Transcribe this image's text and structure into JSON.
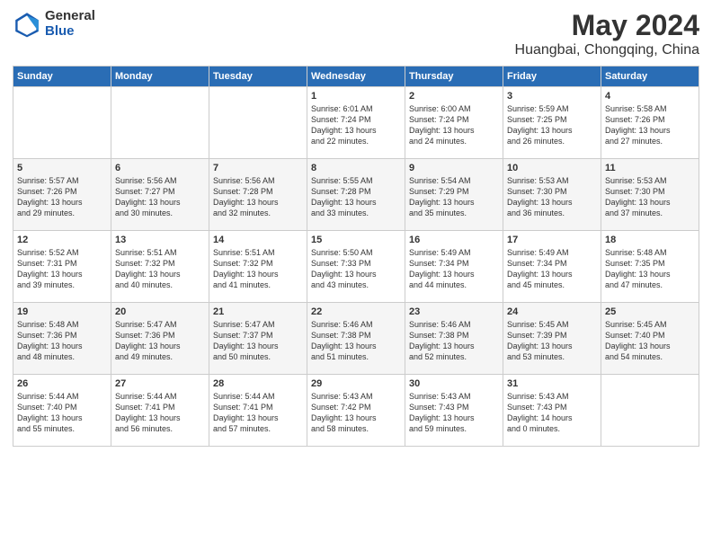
{
  "header": {
    "logo_general": "General",
    "logo_blue": "Blue",
    "title": "May 2024",
    "subtitle": "Huangbai, Chongqing, China"
  },
  "days_of_week": [
    "Sunday",
    "Monday",
    "Tuesday",
    "Wednesday",
    "Thursday",
    "Friday",
    "Saturday"
  ],
  "weeks": [
    [
      {
        "day": "",
        "content": ""
      },
      {
        "day": "",
        "content": ""
      },
      {
        "day": "",
        "content": ""
      },
      {
        "day": "1",
        "content": "Sunrise: 6:01 AM\nSunset: 7:24 PM\nDaylight: 13 hours\nand 22 minutes."
      },
      {
        "day": "2",
        "content": "Sunrise: 6:00 AM\nSunset: 7:24 PM\nDaylight: 13 hours\nand 24 minutes."
      },
      {
        "day": "3",
        "content": "Sunrise: 5:59 AM\nSunset: 7:25 PM\nDaylight: 13 hours\nand 26 minutes."
      },
      {
        "day": "4",
        "content": "Sunrise: 5:58 AM\nSunset: 7:26 PM\nDaylight: 13 hours\nand 27 minutes."
      }
    ],
    [
      {
        "day": "5",
        "content": "Sunrise: 5:57 AM\nSunset: 7:26 PM\nDaylight: 13 hours\nand 29 minutes."
      },
      {
        "day": "6",
        "content": "Sunrise: 5:56 AM\nSunset: 7:27 PM\nDaylight: 13 hours\nand 30 minutes."
      },
      {
        "day": "7",
        "content": "Sunrise: 5:56 AM\nSunset: 7:28 PM\nDaylight: 13 hours\nand 32 minutes."
      },
      {
        "day": "8",
        "content": "Sunrise: 5:55 AM\nSunset: 7:28 PM\nDaylight: 13 hours\nand 33 minutes."
      },
      {
        "day": "9",
        "content": "Sunrise: 5:54 AM\nSunset: 7:29 PM\nDaylight: 13 hours\nand 35 minutes."
      },
      {
        "day": "10",
        "content": "Sunrise: 5:53 AM\nSunset: 7:30 PM\nDaylight: 13 hours\nand 36 minutes."
      },
      {
        "day": "11",
        "content": "Sunrise: 5:53 AM\nSunset: 7:30 PM\nDaylight: 13 hours\nand 37 minutes."
      }
    ],
    [
      {
        "day": "12",
        "content": "Sunrise: 5:52 AM\nSunset: 7:31 PM\nDaylight: 13 hours\nand 39 minutes."
      },
      {
        "day": "13",
        "content": "Sunrise: 5:51 AM\nSunset: 7:32 PM\nDaylight: 13 hours\nand 40 minutes."
      },
      {
        "day": "14",
        "content": "Sunrise: 5:51 AM\nSunset: 7:32 PM\nDaylight: 13 hours\nand 41 minutes."
      },
      {
        "day": "15",
        "content": "Sunrise: 5:50 AM\nSunset: 7:33 PM\nDaylight: 13 hours\nand 43 minutes."
      },
      {
        "day": "16",
        "content": "Sunrise: 5:49 AM\nSunset: 7:34 PM\nDaylight: 13 hours\nand 44 minutes."
      },
      {
        "day": "17",
        "content": "Sunrise: 5:49 AM\nSunset: 7:34 PM\nDaylight: 13 hours\nand 45 minutes."
      },
      {
        "day": "18",
        "content": "Sunrise: 5:48 AM\nSunset: 7:35 PM\nDaylight: 13 hours\nand 47 minutes."
      }
    ],
    [
      {
        "day": "19",
        "content": "Sunrise: 5:48 AM\nSunset: 7:36 PM\nDaylight: 13 hours\nand 48 minutes."
      },
      {
        "day": "20",
        "content": "Sunrise: 5:47 AM\nSunset: 7:36 PM\nDaylight: 13 hours\nand 49 minutes."
      },
      {
        "day": "21",
        "content": "Sunrise: 5:47 AM\nSunset: 7:37 PM\nDaylight: 13 hours\nand 50 minutes."
      },
      {
        "day": "22",
        "content": "Sunrise: 5:46 AM\nSunset: 7:38 PM\nDaylight: 13 hours\nand 51 minutes."
      },
      {
        "day": "23",
        "content": "Sunrise: 5:46 AM\nSunset: 7:38 PM\nDaylight: 13 hours\nand 52 minutes."
      },
      {
        "day": "24",
        "content": "Sunrise: 5:45 AM\nSunset: 7:39 PM\nDaylight: 13 hours\nand 53 minutes."
      },
      {
        "day": "25",
        "content": "Sunrise: 5:45 AM\nSunset: 7:40 PM\nDaylight: 13 hours\nand 54 minutes."
      }
    ],
    [
      {
        "day": "26",
        "content": "Sunrise: 5:44 AM\nSunset: 7:40 PM\nDaylight: 13 hours\nand 55 minutes."
      },
      {
        "day": "27",
        "content": "Sunrise: 5:44 AM\nSunset: 7:41 PM\nDaylight: 13 hours\nand 56 minutes."
      },
      {
        "day": "28",
        "content": "Sunrise: 5:44 AM\nSunset: 7:41 PM\nDaylight: 13 hours\nand 57 minutes."
      },
      {
        "day": "29",
        "content": "Sunrise: 5:43 AM\nSunset: 7:42 PM\nDaylight: 13 hours\nand 58 minutes."
      },
      {
        "day": "30",
        "content": "Sunrise: 5:43 AM\nSunset: 7:43 PM\nDaylight: 13 hours\nand 59 minutes."
      },
      {
        "day": "31",
        "content": "Sunrise: 5:43 AM\nSunset: 7:43 PM\nDaylight: 14 hours\nand 0 minutes."
      },
      {
        "day": "",
        "content": ""
      }
    ]
  ]
}
